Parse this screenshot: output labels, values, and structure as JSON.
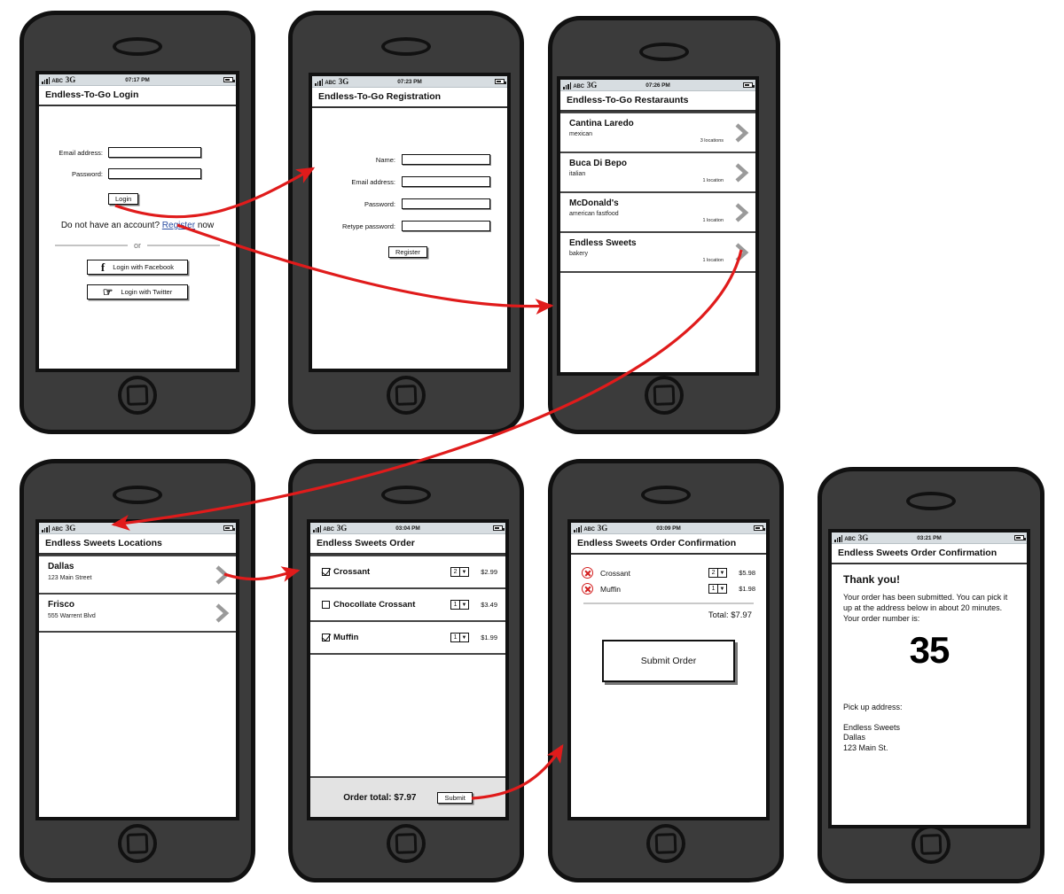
{
  "status_bar": {
    "carrier": "ABC",
    "network": "3G",
    "signal_icon": "signal-bars-icon",
    "battery_icon": "battery-icon"
  },
  "screens": [
    {
      "id": "login",
      "title": "Endless-To-Go Login",
      "time": "07:17 PM",
      "fields": [
        {
          "label": "Email address:",
          "value": ""
        },
        {
          "label": "Password:",
          "value": ""
        }
      ],
      "login_button": "Login",
      "register_prompt_before": "Do not have an account? ",
      "register_link": "Register",
      "register_prompt_after": " now",
      "or_text": "or",
      "social_buttons": [
        {
          "label": "Login with Facebook",
          "icon": "facebook-icon",
          "glyph": "f"
        },
        {
          "label": "Login with Twitter",
          "icon": "twitter-icon",
          "glyph": "☞"
        }
      ]
    },
    {
      "id": "registration",
      "title": "Endless-To-Go Registration",
      "time": "07:23 PM",
      "fields": [
        {
          "label": "Name:",
          "value": ""
        },
        {
          "label": "Email address:",
          "value": ""
        },
        {
          "label": "Password:",
          "value": ""
        },
        {
          "label": "Retype password:",
          "value": ""
        }
      ],
      "register_button": "Register"
    },
    {
      "id": "restaurants",
      "title": "Endless-To-Go Restaraunts",
      "time": "07:26 PM",
      "rows": [
        {
          "name": "Cantina Laredo",
          "cuisine": "mexican",
          "locations": "3 locations"
        },
        {
          "name": "Buca Di Bepo",
          "cuisine": "italian",
          "locations": "1 location"
        },
        {
          "name": "McDonald's",
          "cuisine": "american fastfood",
          "locations": "1 location"
        },
        {
          "name": "Endless Sweets",
          "cuisine": "bakery",
          "locations": "1 location"
        }
      ]
    },
    {
      "id": "locations",
      "title": "Endless Sweets Locations",
      "time": "",
      "rows": [
        {
          "name": "Dallas",
          "address": "123 Main Street"
        },
        {
          "name": "Frisco",
          "address": "555 Warrent Blvd"
        }
      ]
    },
    {
      "id": "order",
      "title": "Endless Sweets Order",
      "time": "03:04 PM",
      "items": [
        {
          "name": "Crossant",
          "checked": true,
          "qty": "2",
          "price": "$2.99"
        },
        {
          "name": "Chocollate Crossant",
          "checked": false,
          "qty": "1",
          "price": "$3.49"
        },
        {
          "name": "Muffin",
          "checked": true,
          "qty": "1",
          "price": "$1.99"
        }
      ],
      "order_total": "Order total: $7.97",
      "submit_button": "Submit"
    },
    {
      "id": "order-confirmation",
      "title": "Endless Sweets Order Confirmation",
      "time": "03:09 PM",
      "items": [
        {
          "name": "Crossant",
          "qty": "2",
          "price": "$5.98"
        },
        {
          "name": "Muffin",
          "qty": "1",
          "price": "$1.98"
        }
      ],
      "total": "Total: $7.97",
      "submit_button": "Submit Order"
    },
    {
      "id": "thank-you",
      "title": "Endless Sweets Order Confirmation",
      "time": "03:21 PM",
      "heading": "Thank you!",
      "message": "Your order has been submitted. You can pick it up at the address below in about 20 minutes. Your order number is:",
      "order_number": "35",
      "pickup_label": "Pick up address:",
      "pickup_address_line1": "Endless Sweets",
      "pickup_address_line2": "Dallas",
      "pickup_address_line3": "123 Main St."
    }
  ],
  "colors": {
    "arrow": "#e01b1b",
    "phone_body": "#3b3b3b",
    "link": "#2b4ea2",
    "status_bar": "#d7dde1",
    "remove_icon": "#d32020"
  }
}
